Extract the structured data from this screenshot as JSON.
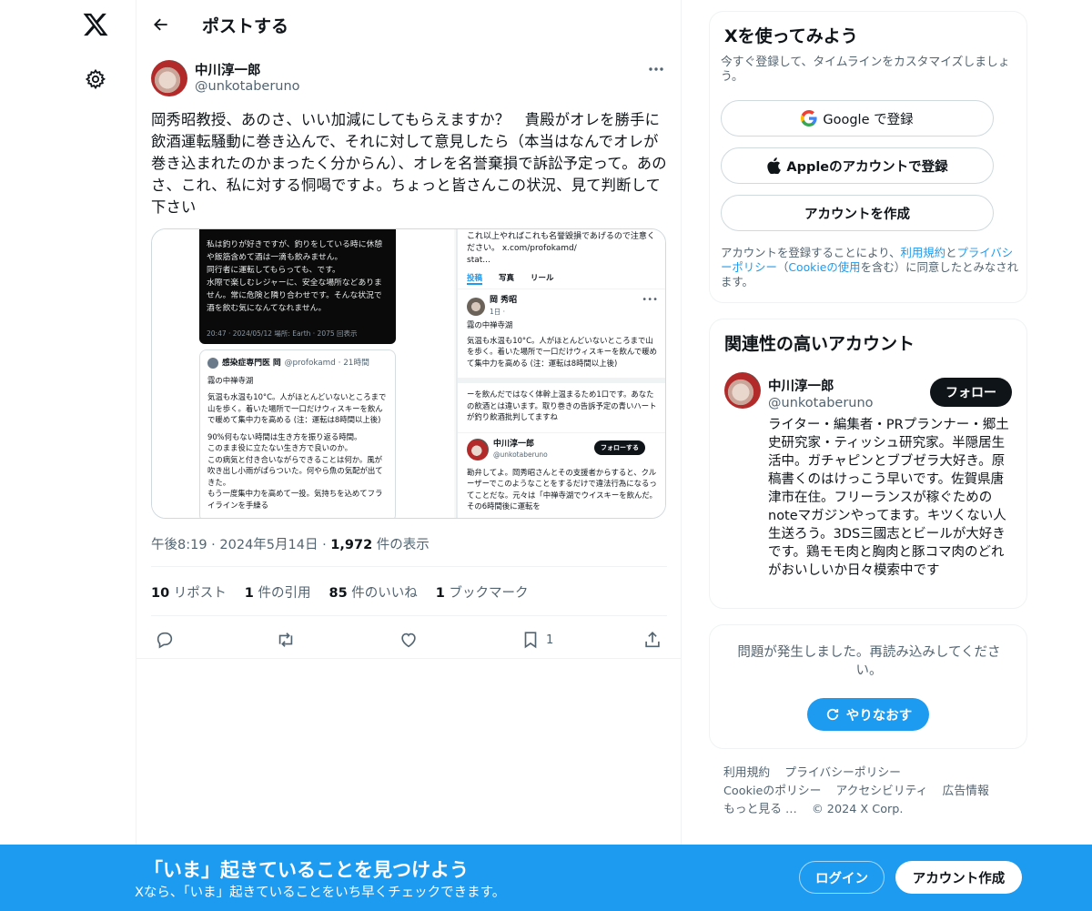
{
  "header": {
    "title": "ポストする"
  },
  "post": {
    "author_name": "中川淳一郎",
    "author_handle": "@unkotaberuno",
    "text": "岡秀昭教授、あのさ、いい加減にしてもらえますか？　貴殿がオレを勝手に飲酒運転騒動に巻き込んで、それに対して意見したら（本当はなんでオレが巻き込まれたのかまったく分からん）、オレを名誉棄損で訴訟予定って。あのさ、これ、私に対する恫喝ですよ。ちょっと皆さんこの状況、見て判断して下さい",
    "time": "午後8:19",
    "date": "2024年5月14日",
    "views_count": "1,972",
    "views_label": "件の表示",
    "stats": {
      "reposts_count": "10",
      "reposts_label": "リポスト",
      "quotes_count": "1",
      "quotes_label": "件の引用",
      "likes_count": "85",
      "likes_label": "件のいいね",
      "bookmarks_count": "1",
      "bookmarks_label": "ブックマーク"
    },
    "bookmark_action_count": "1"
  },
  "media": {
    "dark_text": "私は釣りが好きですが、釣りをしている時に休憩や飯筋含めて酒は一滴も飲みません。\n同行者に運転してもらっても、です。\n水際で楽しむレジャーに、安全な場所などありません。常に危険と隣り合わせです。そんな状況で酒を飲む気になんてなれません。",
    "dark_meta": "20:47 · 2024/05/12 場所: Earth · 2075 回表示",
    "quote_name": "感染症専門医 岡",
    "quote_handle": "@profokamd · 21時間",
    "quote_p1": "霧の中禅寺湖",
    "quote_p2": "気温も水温も10°C。人がほとんどいないところまで山を歩く。着いた場所で一口だけウィスキーを飲んで暖めて集中力を高める (注：運転は8時間以上後)",
    "quote_p3": "90%何もない時間は生き方を振り返る時間。\nこのまま役に立たない生き方で良いのか。\nこの病気と付き合いながらできることは何か。風が吹き出し小雨がぱらついた。何やら魚の気配が出てきた。\nもう一度集中力を高めて一投。気持ちを込めてフライラインを手繰る",
    "right_top": "これ以上やればこれも名誉毀損であげるので注意ください。 x.com/profokamd/\nstat...",
    "tabs": [
      "投稿",
      "写真",
      "リール"
    ],
    "r1_name": "岡 秀昭",
    "r1_sub": "1日 · ",
    "r1_p1": "霧の中禅寺湖",
    "r1_p2": "気温も水温も10°C。人がほとんどいないところまで山を歩く。着いた場所で一口だけウィスキーを飲んで暖めて集中力を高める (注：運転は8時間以上後)",
    "r_mid": "ーを飲んだではなく体幹上温まるため1口です。あなたの飲酒とは違います。取り巻きの告訴予定の青いハートが釣り飲酒批判してますね",
    "r2_name": "中川淳一郎",
    "r2_handle": "@unkotaberuno",
    "r2_follow": "フォローする",
    "r2_p": "勘弁してよ。岡秀昭さんとその支援者からすると、クルーザーでこのようなことをするだけで違法行為になるってことだな。元々は「中禅寺湖でウイスキーを飲んだ。その6時間後に運転を"
  },
  "sidebar": {
    "signup": {
      "title": "Xを使ってみよう",
      "subtitle": "今すぐ登録して、タイムラインをカスタマイズしましょう。",
      "google_label": "Google で登録",
      "apple_label": "Appleのアカウントで登録",
      "create_label": "アカウントを作成",
      "legal_1": "アカウントを登録することにより、",
      "legal_terms": "利用規約",
      "legal_2": "と",
      "legal_privacy": "プライバシーポリシー",
      "legal_3": "（",
      "legal_cookie": "Cookieの使用",
      "legal_4": "を含む）に同意したとみなされます。"
    },
    "related": {
      "title": "関連性の高いアカウント",
      "name": "中川淳一郎",
      "handle": "@unkotaberuno",
      "follow_label": "フォロー",
      "bio": "ライター・編集者・PRプランナー・郷土史研究家・ティッシュ研究家。半隠居生活中。ガチャピンとブブゼラ大好き。原稿書くのはけっこう早いです。佐賀県唐津市在住。フリーランスが稼ぐためのnoteマガジンやってます。キツくない人生送ろう。3DS三國志とビールが大好きです。鶏モモ肉と胸肉と豚コマ肉のどれがおいしいか日々模索中です"
    },
    "error": {
      "text": "問題が発生しました。再読み込みしてください。",
      "retry_label": "やりなおす"
    },
    "footer": {
      "links": [
        "利用規約",
        "プライバシーポリシー",
        "Cookieのポリシー",
        "アクセシビリティ",
        "広告情報",
        "もっと見る …",
        "© 2024 X Corp."
      ]
    }
  },
  "banner": {
    "title": "「いま」起きていることを見つけよう",
    "subtitle": "Xなら、「いま」起きていることをいち早くチェックできます。",
    "login_label": "ログイン",
    "signup_label": "アカウント作成"
  },
  "colors": {
    "accent": "#1d9bf0",
    "text": "#0f1419",
    "muted": "#536471"
  }
}
